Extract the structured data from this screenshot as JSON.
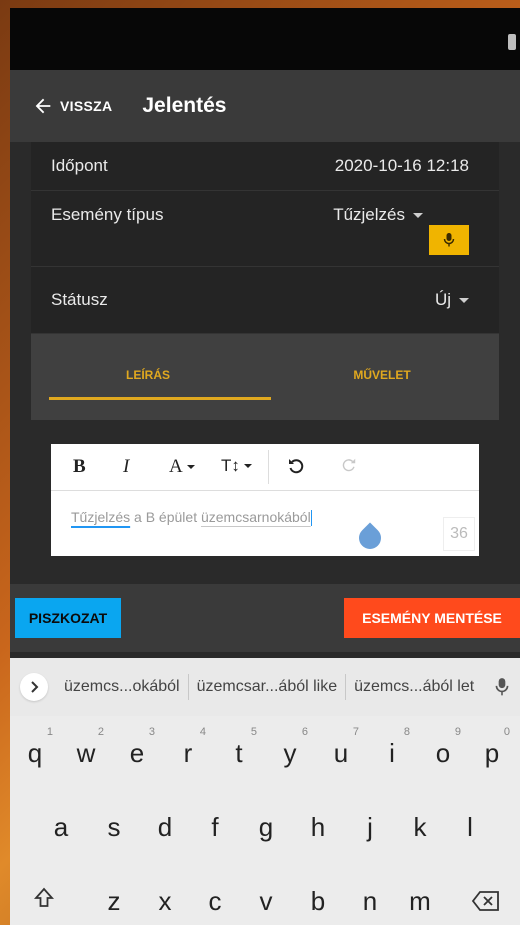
{
  "appbar": {
    "back_label": "VISSZA",
    "title": "Jelentés"
  },
  "form": {
    "time_label": "Időpont",
    "time_value": "2020-10-16 12:18",
    "event_type_label": "Esemény típus",
    "event_type_value": "Tűzjelzés",
    "status_label": "Státusz",
    "status_value": "Új"
  },
  "tabs": [
    {
      "label": "LEÍRÁS",
      "selected": true
    },
    {
      "label": "MŰVELET",
      "selected": false
    }
  ],
  "editor": {
    "toolbar": {
      "bold": "B",
      "italic": "I",
      "font": "A",
      "size": "T↕"
    },
    "text_part1": "Tűzjelzés",
    "text_part2": " a B épület ",
    "text_part3": "üzemcsarnokából",
    "counter": "36"
  },
  "actions": {
    "draft_label": "PISZKOZAT",
    "save_label": "ESEMÉNY MENTÉSE"
  },
  "keyboard": {
    "suggestions": [
      "üzemcs...okából",
      "üzemcsar...ából like",
      "üzemcs...ából let"
    ],
    "row1": [
      "q",
      "w",
      "e",
      "r",
      "t",
      "y",
      "u",
      "i",
      "o",
      "p"
    ],
    "row1_hints": [
      "1",
      "2",
      "3",
      "4",
      "5",
      "6",
      "7",
      "8",
      "9",
      "0"
    ],
    "row2": [
      "a",
      "s",
      "d",
      "f",
      "g",
      "h",
      "j",
      "k",
      "l"
    ],
    "row3": [
      "z",
      "x",
      "c",
      "v",
      "b",
      "n",
      "m"
    ]
  },
  "colors": {
    "accent": "#e0a81f",
    "draft": "#0aa6f0",
    "save": "#ff4a1c",
    "mic": "#f0b400"
  }
}
